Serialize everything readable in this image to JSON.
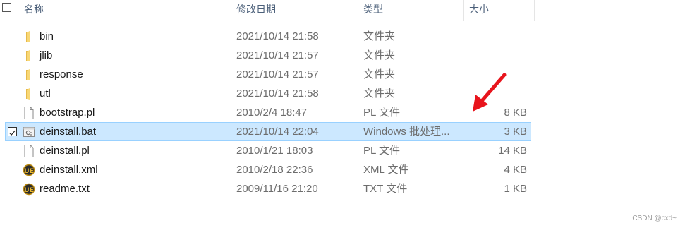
{
  "header": {
    "col_name": "名称",
    "col_date": "修改日期",
    "col_type": "类型",
    "col_size": "大小"
  },
  "files": [
    {
      "name": "bin",
      "date": "2021/10/14 21:58",
      "type": "文件夹",
      "size": "",
      "icon": "folder-icon"
    },
    {
      "name": "jlib",
      "date": "2021/10/14 21:57",
      "type": "文件夹",
      "size": "",
      "icon": "folder-icon"
    },
    {
      "name": "response",
      "date": "2021/10/14 21:57",
      "type": "文件夹",
      "size": "",
      "icon": "folder-icon"
    },
    {
      "name": "utl",
      "date": "2021/10/14 21:58",
      "type": "文件夹",
      "size": "",
      "icon": "folder-icon"
    },
    {
      "name": "bootstrap.pl",
      "date": "2010/2/4 18:47",
      "type": "PL 文件",
      "size": "8 KB",
      "icon": "file-icon"
    },
    {
      "name": "deinstall.bat",
      "date": "2021/10/14 22:04",
      "type": "Windows 批处理...",
      "size": "3 KB",
      "icon": "batch-file-icon",
      "selected": true
    },
    {
      "name": "deinstall.pl",
      "date": "2010/1/21 18:03",
      "type": "PL 文件",
      "size": "14 KB",
      "icon": "file-icon"
    },
    {
      "name": "deinstall.xml",
      "date": "2010/2/18 22:36",
      "type": "XML 文件",
      "size": "4 KB",
      "icon": "ue-icon"
    },
    {
      "name": "readme.txt",
      "date": "2009/11/16 21:20",
      "type": "TXT 文件",
      "size": "1 KB",
      "icon": "ue-icon"
    }
  ],
  "watermark": "CSDN @cxd~",
  "colors": {
    "selection_bg": "#cce8ff",
    "selection_border": "#99d1ff",
    "folder": "#f8d775",
    "arrow": "#e8141c"
  }
}
